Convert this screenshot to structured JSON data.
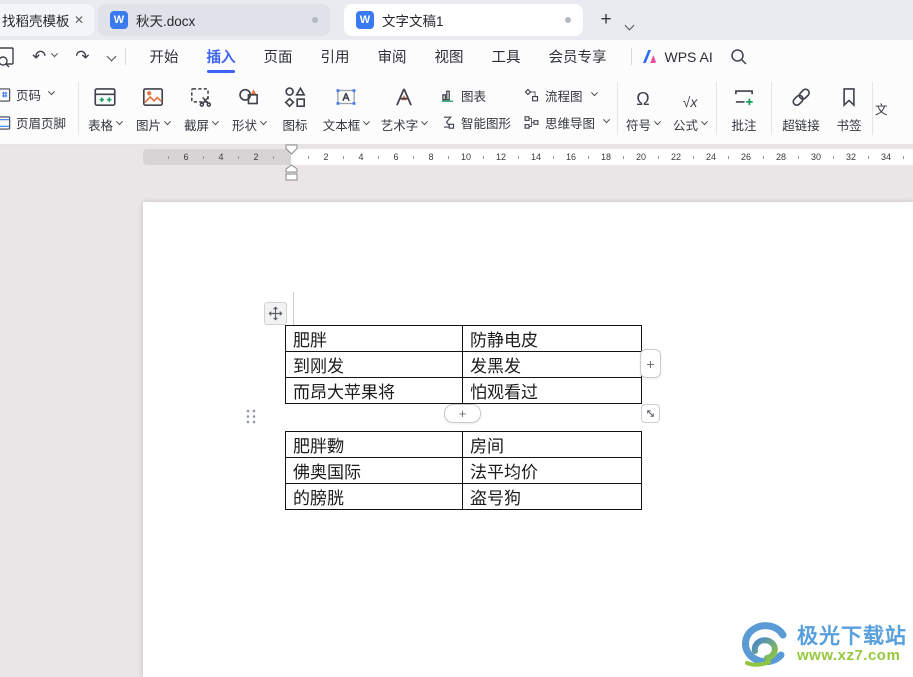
{
  "tab_bar": {
    "tabs": [
      {
        "label": "找稻壳模板"
      },
      {
        "label": "秋天.docx"
      },
      {
        "label": "文字文稿1"
      }
    ]
  },
  "menubar": {
    "items": [
      "开始",
      "插入",
      "页面",
      "引用",
      "审阅",
      "视图",
      "工具",
      "会员专享"
    ],
    "active_item": "插入",
    "wps_ai_label": "WPS AI"
  },
  "toolbar": {
    "page_number_label": "页码",
    "header_footer_label": "页眉页脚",
    "buttons": {
      "table": "表格",
      "picture": "图片",
      "screenshot": "截屏",
      "shapes": "形状",
      "icon_library": "图标",
      "textbox": "文本框",
      "wordart": "艺术字",
      "chart": "图表",
      "smart_graphic": "智能图形",
      "flowchart": "流程图",
      "mindmap": "思维导图",
      "symbol": "符号",
      "formula": "公式",
      "comment": "批注",
      "hyperlink": "超链接",
      "bookmark": "书签",
      "partial_clipped": "文"
    },
    "glyphs": {
      "symbol": "Ω",
      "formula": "√x"
    }
  },
  "ruler": {
    "left_numbers": [
      "6",
      "4",
      "2"
    ],
    "right_numbers": [
      "2",
      "4",
      "6",
      "8",
      "10",
      "12",
      "14",
      "16",
      "18",
      "20",
      "22",
      "24",
      "26",
      "28",
      "30",
      "32",
      "34"
    ]
  },
  "document": {
    "table1": {
      "rows": [
        [
          "肥胖",
          "防静电皮"
        ],
        [
          "到刚发",
          "发黑发"
        ],
        [
          "而昂大苹果将",
          "怕观看过"
        ]
      ]
    },
    "table2": {
      "rows": [
        [
          "肥胖覅",
          "房间"
        ],
        [
          "佛奥国际",
          "法平均价"
        ],
        [
          "的膀胱",
          "盗号狗"
        ]
      ]
    },
    "add_button_label": "+"
  },
  "watermark": {
    "site_name": "极光下载站",
    "site_url": "www.xz7.com"
  },
  "icons": {
    "tab_close": "✕",
    "new_tab": "+",
    "undo": "↶",
    "redo": "↷"
  },
  "colors": {
    "accent_blue": "#3b64f2",
    "wps_doc_blue": "#3a7af0",
    "icon_green": "#18a05e",
    "icon_orange": "#e8743b",
    "watermark_blue": "#58a0dc",
    "watermark_green": "#96c83d",
    "table_border": "#141414"
  }
}
